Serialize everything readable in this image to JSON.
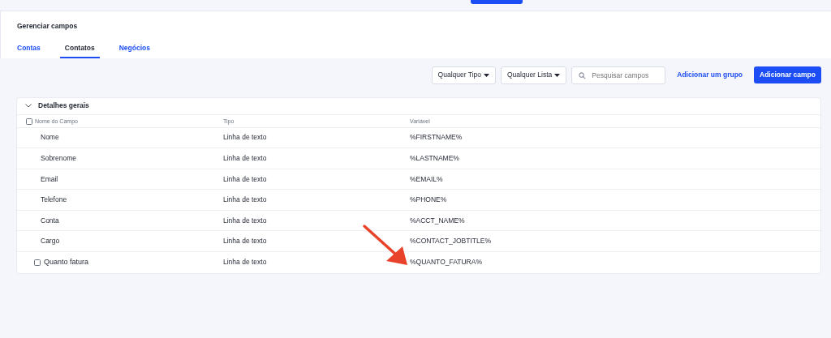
{
  "page": {
    "title": "Gerenciar campos"
  },
  "tabs": [
    {
      "label": "Contas",
      "selected": false
    },
    {
      "label": "Contatos",
      "selected": true
    },
    {
      "label": "Negócios",
      "selected": false
    }
  ],
  "toolbar": {
    "type_filter": "Qualquer Tipo",
    "list_filter": "Qualquer Lista",
    "search": {
      "placeholder": "Pesquisar campos"
    },
    "add_group": "Adicionar um grupo",
    "add_field": "Adicionar campo"
  },
  "group": {
    "title": "Detalhes gerais",
    "expanded": true,
    "columns": [
      {
        "label": "Nome do Campo",
        "kind": "checkbox",
        "checked": false
      },
      {
        "label": "Tipo",
        "kind": "plain"
      },
      {
        "label": "Variável",
        "kind": "plain"
      }
    ],
    "rows": [
      {
        "kind": "standard",
        "name": "Nome",
        "type": "Linha de texto",
        "variable": "%FIRSTNAME%"
      },
      {
        "kind": "standard",
        "name": "Sobrenome",
        "type": "Linha de texto",
        "variable": "%LASTNAME%"
      },
      {
        "kind": "standard",
        "name": "Email",
        "type": "Linha de texto",
        "variable": "%EMAIL%"
      },
      {
        "kind": "standard",
        "name": "Telefone",
        "type": "Linha de texto",
        "variable": "%PHONE%"
      },
      {
        "kind": "standard",
        "name": "Conta",
        "type": "Linha de texto",
        "variable": "%ACCT_NAME%"
      },
      {
        "kind": "standard",
        "name": "Cargo",
        "type": "Linha de texto",
        "variable": "%CONTACT_JOBTITLE%"
      },
      {
        "kind": "custom",
        "name": "Quanto fatura",
        "type": "Linha de texto",
        "variable": "%QUANTO_FATURA%",
        "checked": false
      }
    ]
  }
}
